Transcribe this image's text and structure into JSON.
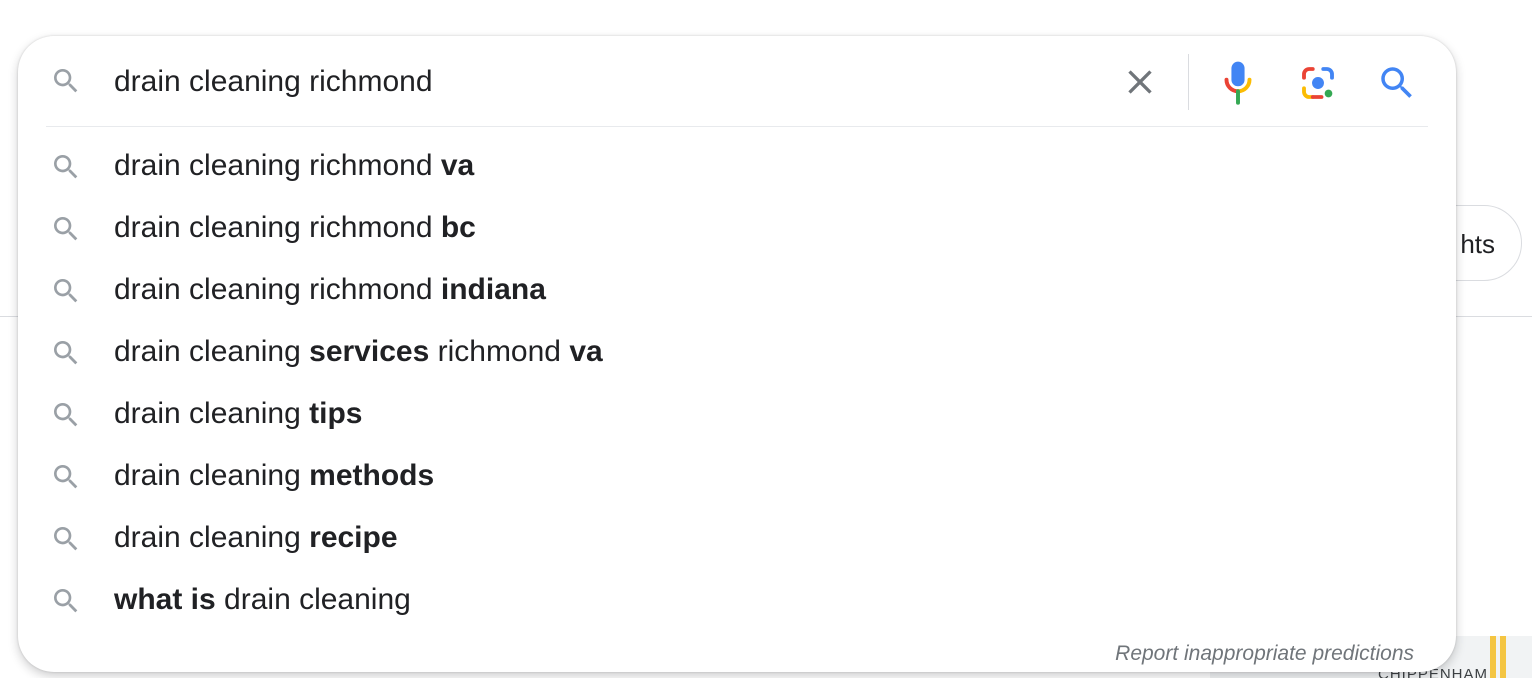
{
  "background": {
    "chip_label": "hts",
    "map_label": "CHIPPENHAM"
  },
  "search": {
    "query": "drain cleaning richmond",
    "icons": {
      "leading": "search-icon",
      "clear": "close-icon",
      "voice": "microphone-icon",
      "image_search": "camera-lens-icon",
      "submit": "search-icon"
    }
  },
  "suggestions": [
    {
      "parts": [
        {
          "text": "drain cleaning richmond ",
          "bold": false
        },
        {
          "text": "va",
          "bold": true
        }
      ]
    },
    {
      "parts": [
        {
          "text": "drain cleaning richmond ",
          "bold": false
        },
        {
          "text": "bc",
          "bold": true
        }
      ]
    },
    {
      "parts": [
        {
          "text": "drain cleaning richmond ",
          "bold": false
        },
        {
          "text": "indiana",
          "bold": true
        }
      ]
    },
    {
      "parts": [
        {
          "text": "drain cleaning ",
          "bold": false
        },
        {
          "text": "services",
          "bold": true
        },
        {
          "text": " richmond ",
          "bold": false
        },
        {
          "text": "va",
          "bold": true
        }
      ]
    },
    {
      "parts": [
        {
          "text": "drain cleaning ",
          "bold": false
        },
        {
          "text": "tips",
          "bold": true
        }
      ]
    },
    {
      "parts": [
        {
          "text": "drain cleaning ",
          "bold": false
        },
        {
          "text": "methods",
          "bold": true
        }
      ]
    },
    {
      "parts": [
        {
          "text": "drain cleaning ",
          "bold": false
        },
        {
          "text": "recipe",
          "bold": true
        }
      ]
    },
    {
      "parts": [
        {
          "text": "what is",
          "bold": true
        },
        {
          "text": " drain cleaning",
          "bold": false
        }
      ]
    }
  ],
  "report_link": "Report inappropriate predictions",
  "colors": {
    "text": "#202124",
    "muted_icon": "#9aa0a6",
    "google_blue": "#4285f4",
    "google_red": "#ea4335",
    "google_yellow": "#fbbc04",
    "google_green": "#34a853"
  }
}
